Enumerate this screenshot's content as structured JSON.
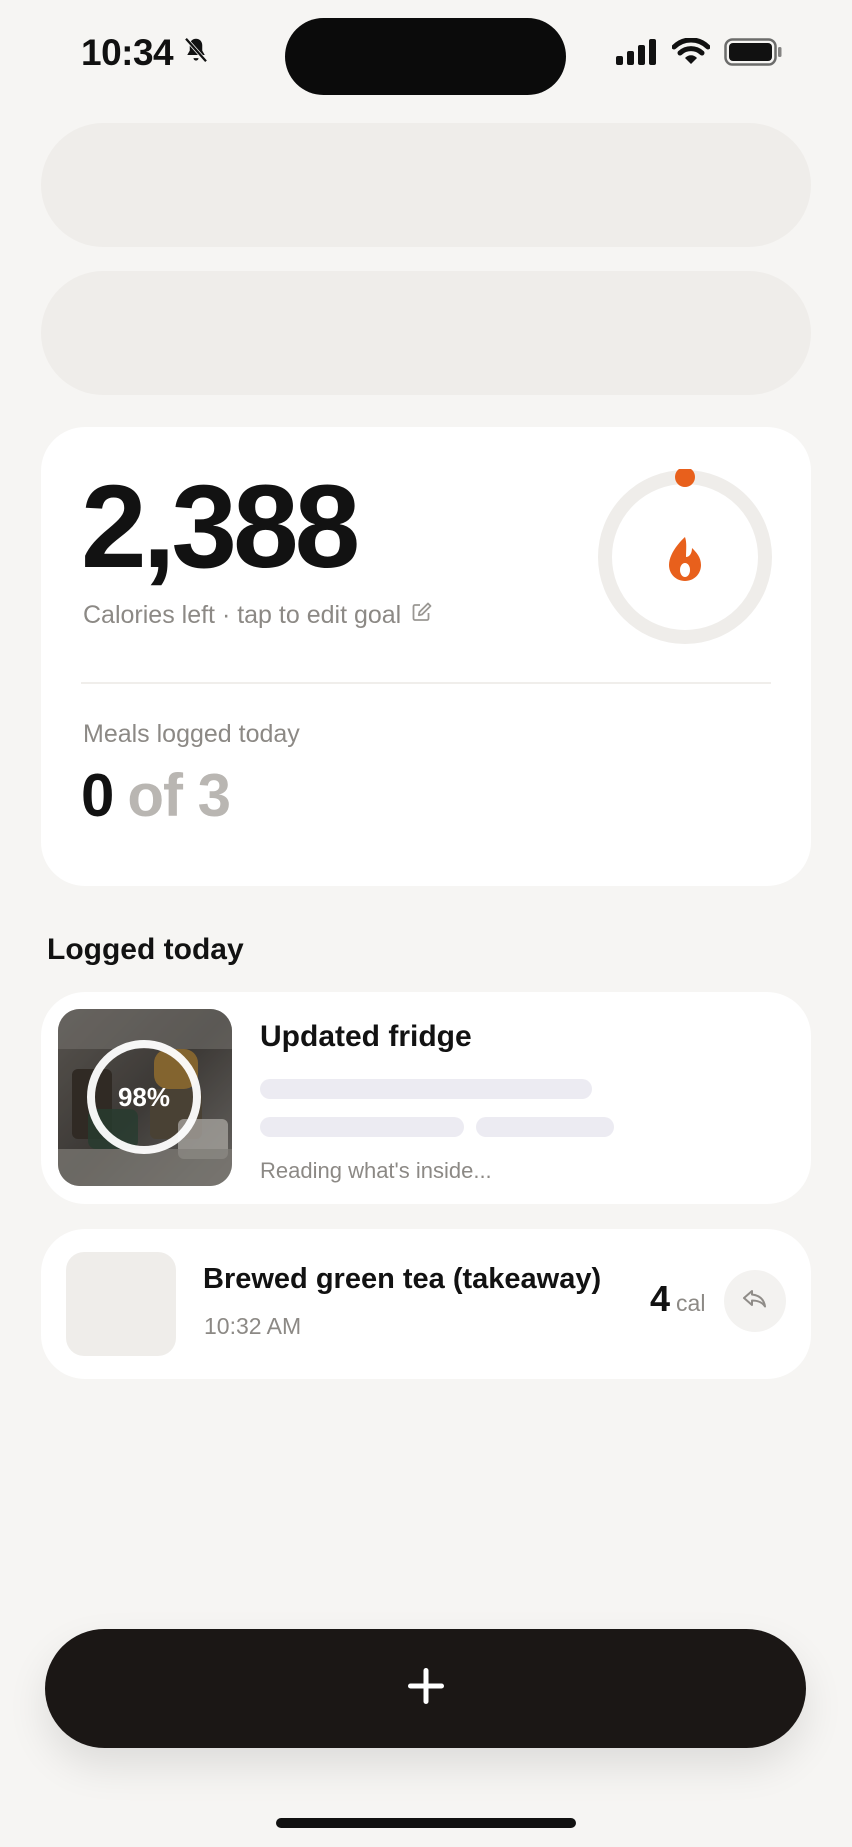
{
  "status_bar": {
    "time": "10:34",
    "icons": [
      "bell-slash-icon",
      "cellular-signal-icon",
      "wifi-icon",
      "battery-icon"
    ]
  },
  "summary": {
    "calories_left": "2,388",
    "calories_subtitle": "Calories left · tap to edit goal",
    "edit_icon": "edit-icon",
    "ring_icon": "flame-icon",
    "meals_label": "Meals logged today",
    "meals_logged": "0",
    "meals_total": "of 3"
  },
  "logged_today": {
    "title": "Logged today",
    "items": [
      {
        "title": "Updated fridge",
        "progress": "98%",
        "progress_value": 0.98,
        "status": "Reading what's inside..."
      },
      {
        "title": "Brewed green tea (takeaway)",
        "time": "10:32 AM",
        "calories": "4",
        "calories_unit": "cal",
        "action_icon": "share-reply-icon"
      }
    ]
  },
  "fab": {
    "icon": "plus-icon"
  },
  "colors": {
    "accent": "#e8601c",
    "background": "#f6f5f3",
    "dark_button": "#1b1715"
  }
}
